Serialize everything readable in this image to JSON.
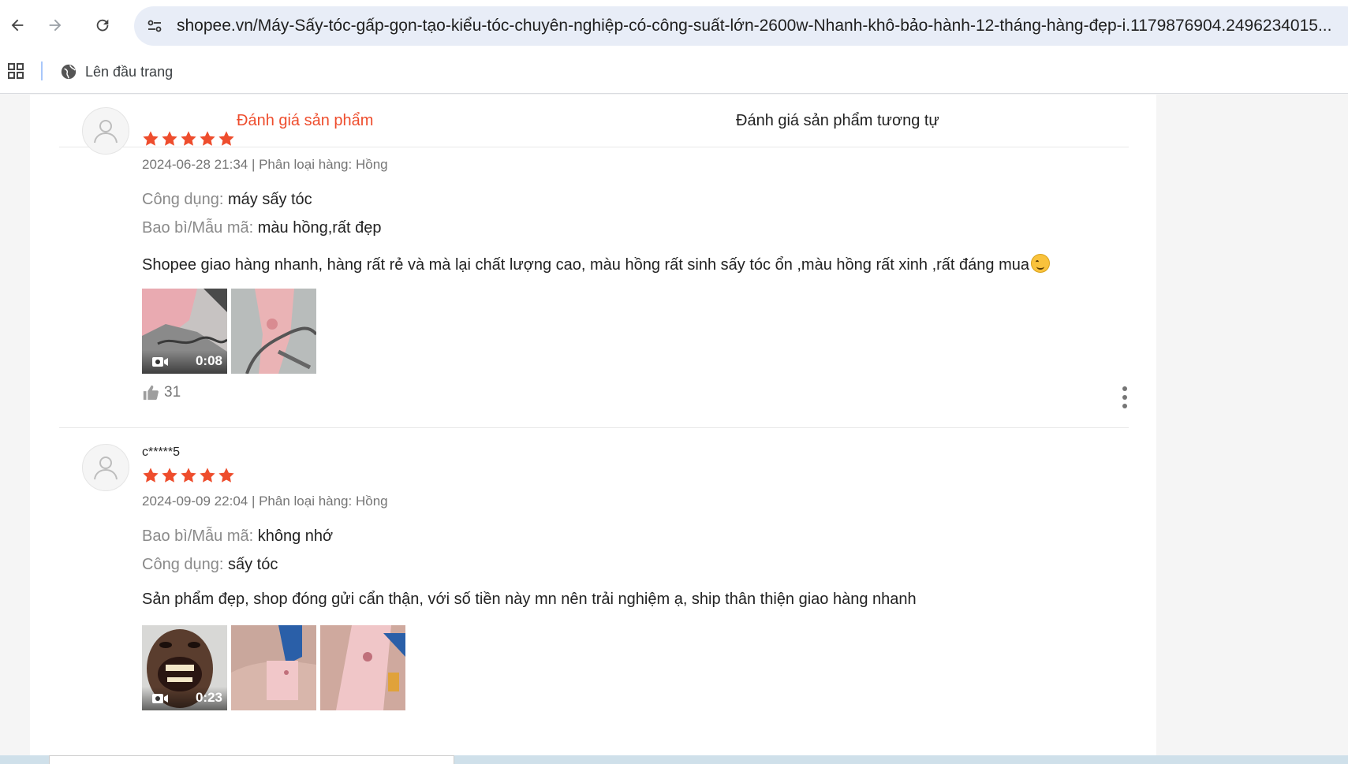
{
  "browser": {
    "url": "shopee.vn/Máy-Sấy-tóc-gấp-gọn-tạo-kiểu-tóc-chuyên-nghiệp-có-công-suất-lớn-2600w-Nhanh-khô-bảo-hành-12-tháng-hàng-đẹp-i.1179876904.2496234015...",
    "bookmark_label": "Lên đầu trang"
  },
  "tabs": {
    "active": "Đánh giá sản phẩm",
    "other": "Đánh giá sản phẩm tương tự"
  },
  "colors": {
    "accent": "#ee4d2d",
    "star": "#ee4d2d"
  },
  "reviews": [
    {
      "username": "",
      "rating": 5,
      "meta": "2024-06-28 21:34 | Phân loại hàng: Hồng",
      "attributes": [
        {
          "key": "Công dụng:",
          "value": "máy sấy tóc"
        },
        {
          "key": "Bao bì/Mẫu mã:",
          "value": "màu hồng,rất đẹp"
        }
      ],
      "comment": "Shopee giao hàng nhanh, hàng rất rẻ và mà lại chất lượng cao, màu hồng rất sinh sấy tóc ổn ,màu hồng rất xinh ,rất đáng mua",
      "media": [
        {
          "type": "video",
          "duration": "0:08"
        },
        {
          "type": "image"
        }
      ],
      "likes": "31"
    },
    {
      "username": "c*****5",
      "rating": 5,
      "meta": "2024-09-09 22:04 | Phân loại hàng: Hồng",
      "attributes": [
        {
          "key": "Bao bì/Mẫu mã:",
          "value": "không nhớ"
        },
        {
          "key": "Công dụng:",
          "value": "sấy tóc"
        }
      ],
      "comment": "Sản phẩm đẹp, shop đóng gửi cẩn thận, với số tiền này mn nên trải nghiệm ạ, ship thân thiện giao hàng nhanh",
      "media": [
        {
          "type": "video",
          "duration": "0:23"
        },
        {
          "type": "image"
        },
        {
          "type": "image"
        }
      ]
    }
  ]
}
